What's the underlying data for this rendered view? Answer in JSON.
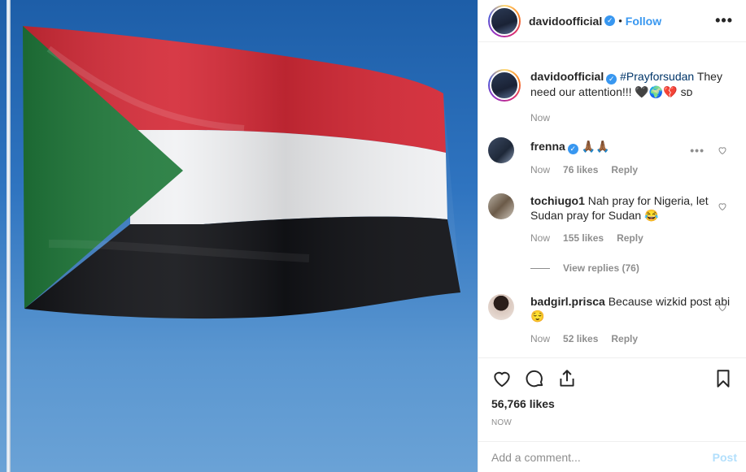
{
  "post": {
    "author": "davidoofficial",
    "follow_label": "Follow",
    "more_label": "•••",
    "separator": "•"
  },
  "caption": {
    "author": "davidoofficial",
    "hashtag": "#Prayforsudan",
    "text": " They need our attention!!! 🖤🌍💔 sᴅ",
    "time": "Now"
  },
  "comments": [
    {
      "author": "frenna",
      "verified": true,
      "text": "🙏🏾🙏🏾",
      "time": "Now",
      "likes": "76 likes",
      "reply": "Reply"
    },
    {
      "author": "tochiugo1",
      "verified": false,
      "text": "Nah pray for Nigeria, let Sudan pray for Sudan 😂",
      "time": "Now",
      "likes": "155 likes",
      "reply": "Reply",
      "view_replies": "View replies (76)"
    },
    {
      "author": "badgirl.prisca",
      "verified": false,
      "text": "Because wizkid post abi 😌",
      "time": "Now",
      "likes": "52 likes",
      "reply": "Reply"
    }
  ],
  "actions": {
    "like_count": "56,766 likes",
    "time": "NOW"
  },
  "composer": {
    "placeholder": "Add a comment...",
    "post_label": "Post"
  },
  "colors": {
    "link_blue": "#3897f0",
    "hashtag": "#003569",
    "muted": "#8e8e8e",
    "flag_red": "#d42a37",
    "flag_white": "#f3f4f6",
    "flag_black": "#111216",
    "flag_green": "#1f7a3a"
  },
  "icons": [
    "verified-badge-icon",
    "heart-icon",
    "comment-icon",
    "share-icon",
    "bookmark-icon",
    "more-icon"
  ]
}
